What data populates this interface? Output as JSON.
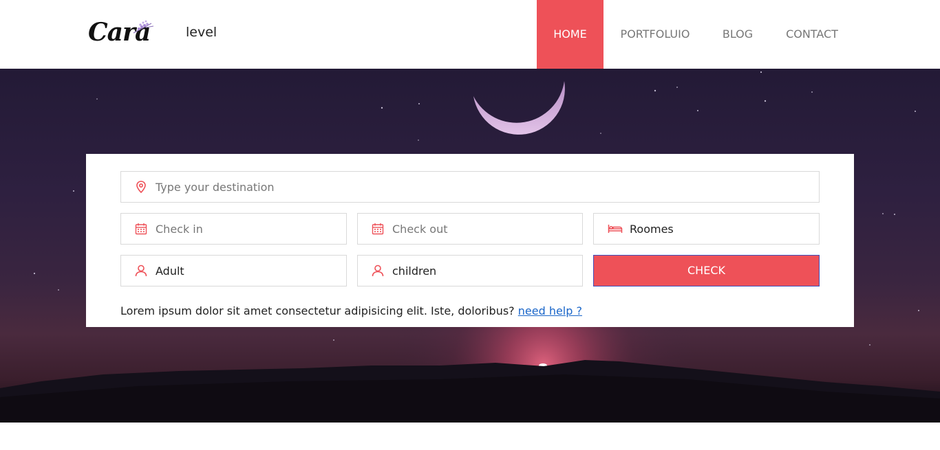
{
  "header": {
    "logo_text": "Cara",
    "brand_sub": "level",
    "nav": [
      {
        "label": "HOME",
        "active": true
      },
      {
        "label": "PORTFOLUIO",
        "active": false
      },
      {
        "label": "BLOG",
        "active": false
      },
      {
        "label": "CONTACT",
        "active": false
      }
    ]
  },
  "booking": {
    "destination_placeholder": "Type your destination",
    "checkin_placeholder": "Check in",
    "checkout_placeholder": "Check out",
    "rooms_value": "Roomes",
    "adult_value": "Adult",
    "children_value": "children",
    "check_button": "CHECK",
    "note_text": "Lorem ipsum dolor sit amet consectetur adipisicing elit. Iste, doloribus? ",
    "help_link": "need help ?"
  },
  "colors": {
    "accent": "#ee5158",
    "link": "#1a66c9",
    "button_border": "#3d4fbd"
  },
  "icons": {
    "destination": "map-pin-icon",
    "checkin": "calendar-icon",
    "checkout": "calendar-icon",
    "rooms": "bed-icon",
    "adult": "user-icon",
    "children": "user-icon",
    "logo_ornament": "lavender-sprig-icon"
  }
}
